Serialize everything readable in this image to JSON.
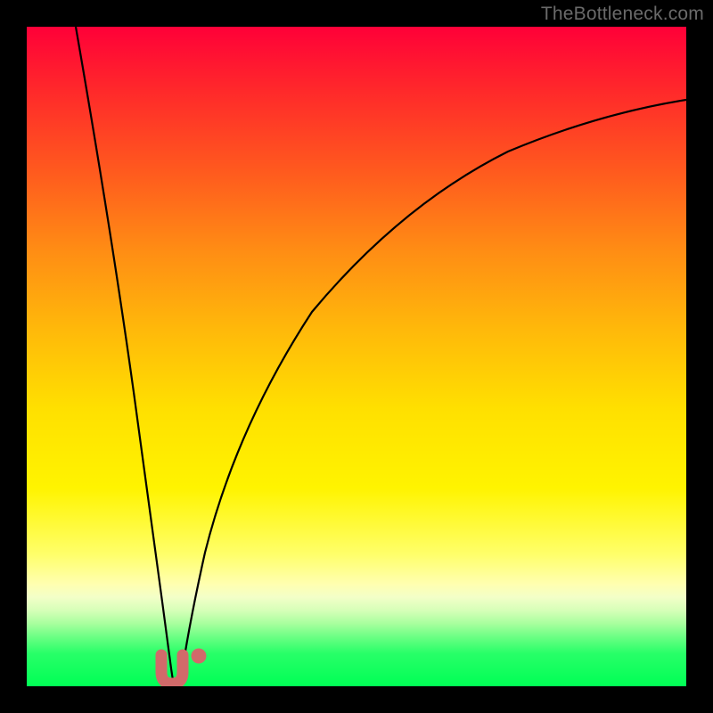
{
  "watermark": {
    "text": "TheBottleneck.com"
  },
  "colors": {
    "frame": "#000000",
    "curve_stroke": "#000000",
    "marker_fill": "#d16a6a",
    "marker_stroke": "#c95e5e",
    "gradient_stops": [
      "#ff0038",
      "#ff2a2a",
      "#ff5a1e",
      "#ff8d14",
      "#ffb90a",
      "#ffe000",
      "#fff400",
      "#ffff6a",
      "#ffffb0",
      "#f3ffc8",
      "#d6ffb8",
      "#a8ff9e",
      "#6cff84",
      "#28ff68",
      "#00ff55"
    ]
  },
  "chart_data": {
    "type": "line",
    "title": "",
    "xlabel": "",
    "ylabel": "",
    "xlim": [
      0,
      100
    ],
    "ylim": [
      0,
      100
    ],
    "grid": false,
    "legend": false,
    "series": [
      {
        "name": "left-branch",
        "x": [
          8,
          10,
          12,
          14,
          16,
          18,
          19,
          20,
          21
        ],
        "y": [
          100,
          80,
          60,
          42,
          28,
          16,
          9,
          4,
          0
        ]
      },
      {
        "name": "right-branch",
        "x": [
          22,
          23,
          24,
          26,
          30,
          36,
          44,
          54,
          66,
          80,
          100
        ],
        "y": [
          0,
          4,
          9,
          18,
          32,
          46,
          59,
          70,
          79,
          85,
          88
        ]
      }
    ],
    "markers": [
      {
        "name": "bottom-u-marker",
        "shape": "U",
        "x": 21,
        "y": 1,
        "size": 4
      },
      {
        "name": "bottom-dot-marker",
        "shape": "dot",
        "x": 24,
        "y": 3,
        "size": 2
      }
    ],
    "annotations": [
      {
        "text": "TheBottleneck.com",
        "pos": "top-right"
      }
    ]
  }
}
